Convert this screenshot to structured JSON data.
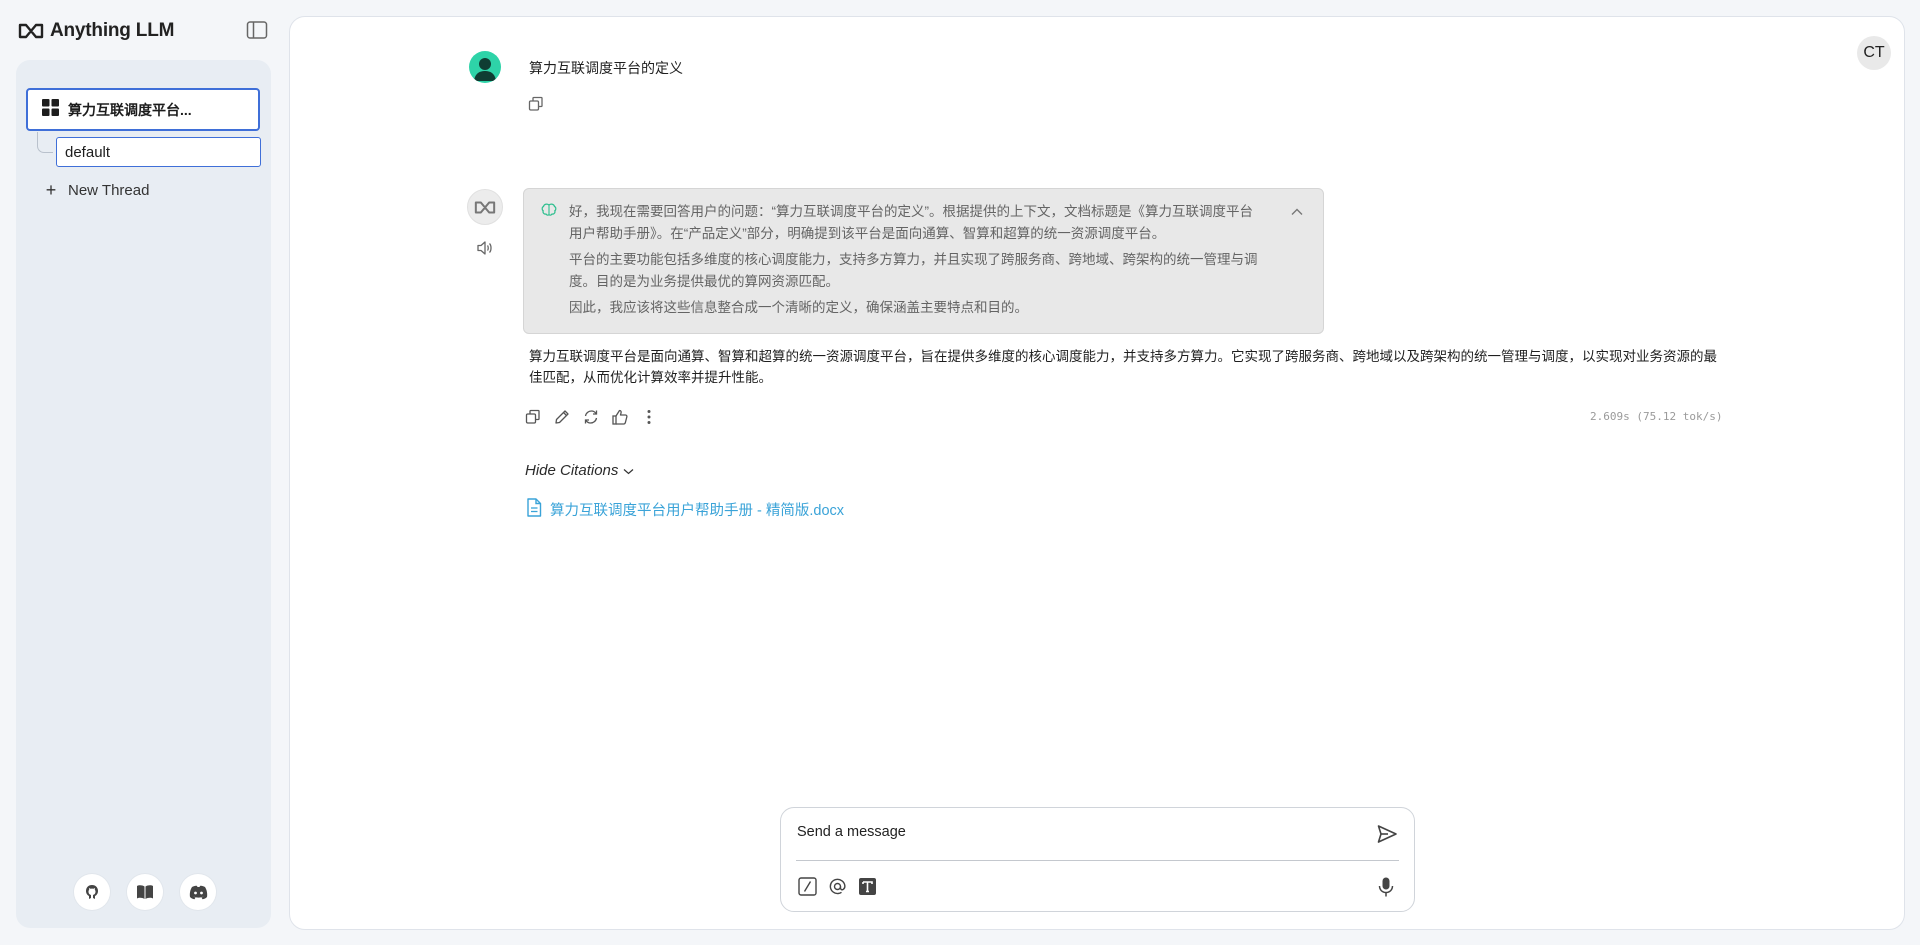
{
  "app": {
    "brand": "Anything LLM"
  },
  "sidebar": {
    "workspace": {
      "label": "算力互联调度平台..."
    },
    "thread": {
      "label": "default"
    },
    "new_thread": {
      "label": "New Thread",
      "icon": "plus-icon"
    },
    "footer_icons": [
      "github-icon",
      "docs-book-icon",
      "discord-icon"
    ]
  },
  "header": {
    "user_initials": "CT"
  },
  "chat": {
    "user_message": "算力互联调度平台的定义",
    "thought": {
      "paragraphs": [
        "好，我现在需要回答用户的问题：“算力互联调度平台的定义”。根据提供的上下文，文档标题是《算力互联调度平台用户帮助手册》。在“产品定义”部分，明确提到该平台是面向通算、智算和超算的统一资源调度平台。",
        "平台的主要功能包括多维度的核心调度能力，支持多方算力，并且实现了跨服务商、跨地域、跨架构的统一管理与调度。目的是为业务提供最优的算网资源匹配。",
        "因此，我应该将这些信息整合成一个清晰的定义，确保涵盖主要特点和目的。"
      ]
    },
    "answer": "算力互联调度平台是面向通算、智算和超算的统一资源调度平台，旨在提供多维度的核心调度能力，并支持多方算力。它实现了跨服务商、跨地域以及跨架构的统一管理与调度，以实现对业务资源的最佳匹配，从而优化计算效率并提升性能。",
    "metrics": "2.609s (75.12 tok/s)",
    "citations_toggle": "Hide Citations",
    "citations": [
      {
        "label": "算力互联调度平台用户帮助手册 - 精简版.docx"
      }
    ]
  },
  "composer": {
    "placeholder": "Send a message",
    "value": ""
  },
  "colors": {
    "accent_border": "#3f6fd8",
    "citation_link": "#3aa3d8",
    "user_avatar": "#2ed3a8",
    "thought_bg": "#e8e8e8"
  }
}
